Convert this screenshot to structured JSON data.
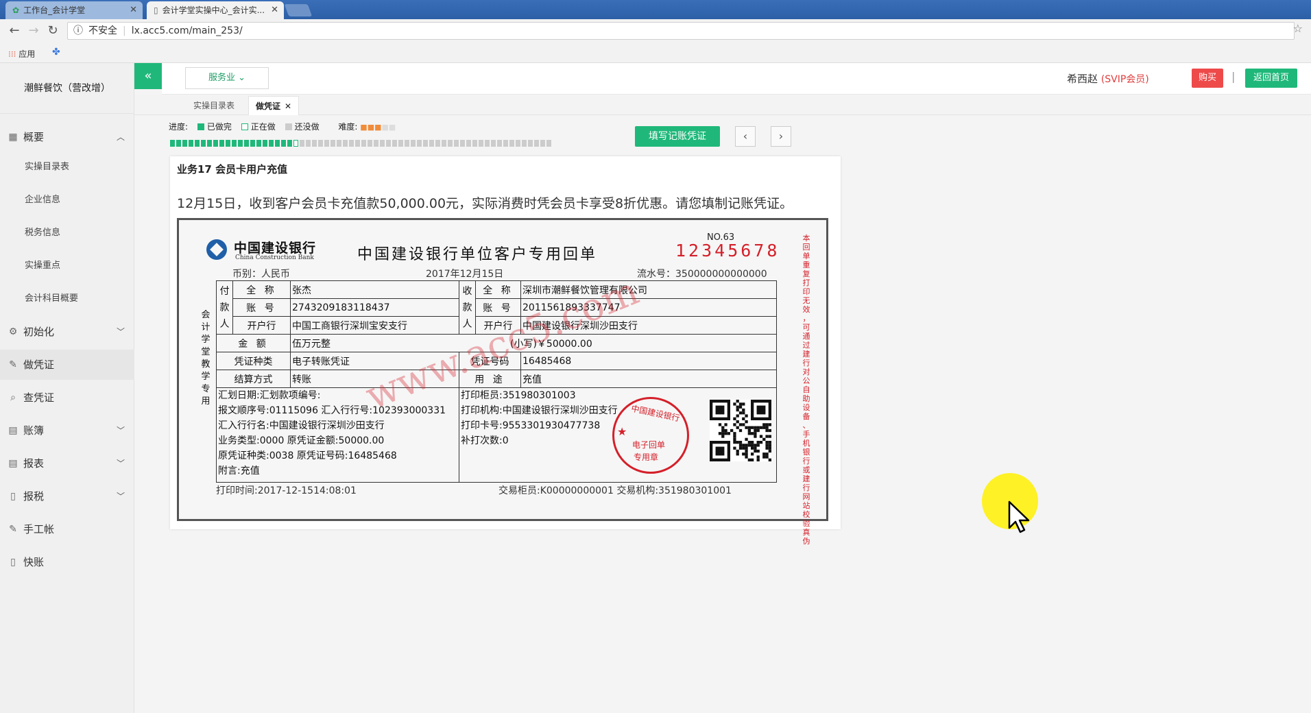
{
  "browser": {
    "tabs": [
      {
        "label": "工作台_会计学堂"
      },
      {
        "label": "会计学堂实操中心_会计实..."
      }
    ],
    "url": "lx.acc5.com/main_253/",
    "security_label": "不安全",
    "bookmarks_apps": "应用"
  },
  "sidebar": {
    "company": "潮鲜餐饮（营改增）",
    "menu": [
      {
        "label": "概要"
      },
      {
        "label": "初始化"
      },
      {
        "label": "做凭证"
      },
      {
        "label": "查凭证"
      },
      {
        "label": "账簿"
      },
      {
        "label": "报表"
      },
      {
        "label": "报税"
      },
      {
        "label": "手工帐"
      },
      {
        "label": "快账"
      }
    ],
    "submenu": [
      {
        "label": "实操目录表"
      },
      {
        "label": "企业信息"
      },
      {
        "label": "税务信息"
      },
      {
        "label": "实操重点"
      },
      {
        "label": "会计科目概要"
      }
    ]
  },
  "header": {
    "service_dropdown": "服务业",
    "user_name": "希西赵",
    "vip_label": "(SVIP会员)",
    "buy_label": "购买",
    "home_label": "返回首页"
  },
  "page_tabs": [
    {
      "label": "实操目录表"
    },
    {
      "label": "做凭证"
    }
  ],
  "progress": {
    "label": "进度:",
    "done": "已做完",
    "doing": "正在做",
    "todo": "还没做",
    "difficulty_label": "难度:",
    "difficulty_level": 3,
    "difficulty_max": 5,
    "done_count": 20,
    "current_index": 21,
    "total_segments": 62,
    "fill_button": "填写记账凭证"
  },
  "colors": {
    "accent": "#1fb87a",
    "danger": "#ee4a4a",
    "seal_red": "#d4202a",
    "bank_blue": "#1f5fa8"
  },
  "task": {
    "title": "业务17 会员卡用户充值",
    "description": "12月15日，收到客户会员卡充值款50,000.00元，实际消费时凭会员卡享受8折优惠。请您填制记账凭证。"
  },
  "receipt": {
    "bank_cn": "中国建设银行",
    "bank_en": "China Construction Bank",
    "title": "中国建设银行单位客户专用回单",
    "no_label": "NO.63",
    "no_value": "12345678",
    "currency": "币别：人民币",
    "date": "2017年12月15日",
    "serial": "流水号：350000000000000",
    "payer_tag": [
      "付",
      "款",
      "人"
    ],
    "payee_tag": [
      "收",
      "款",
      "人"
    ],
    "lbl_name": "全 称",
    "lbl_account": "账 号",
    "lbl_bank": "开户行",
    "lbl_amount": "金 额",
    "lbl_vtype": "凭证种类",
    "lbl_vno": "凭证号码",
    "lbl_settle": "结算方式",
    "lbl_use": "用 途",
    "payer_name": "张杰",
    "payer_account": "2743209183118437",
    "payer_bank": "中国工商银行深圳宝安支行",
    "payee_name": "深圳市潮鲜餐饮管理有限公司",
    "payee_account": "2011561893337747",
    "payee_bank": "中国建设银行深圳沙田支行",
    "amount_cn": "伍万元整",
    "amount_small": "(小写)￥50000.00",
    "voucher_type": "电子转账凭证",
    "voucher_no": "16485468",
    "settle_method": "转账",
    "purpose": "充值",
    "left_info": [
      "汇划日期:汇划款项编号:",
      "报文顺序号:01115096 汇入行行号:102393000331",
      "汇入行行名:中国建设银行深圳沙田支行",
      "业务类型:0000 原凭证金额:50000.00",
      "原凭证种类:0038 原凭证号码:16485468",
      "附言:充值"
    ],
    "right_info": [
      "打印柜员:351980301003",
      "打印机构:中国建设银行深圳沙田支行",
      "打印卡号:9553301930477738",
      "补打次数:0"
    ],
    "print_time": "打印时间:2017-12-1514:08:01",
    "trade_info": "交易柜员:K00000000001 交易机构:351980301001",
    "left_vertical": "会计学堂教学专用",
    "right_vertical": "本回单重复打印无效，可通过建行对公自助设备、手机银行或建行网站校验真伪",
    "seal_top": "中国建设银行",
    "seal_line1": "电子回单",
    "seal_line2": "专用章",
    "watermark": "www.acc5.com"
  }
}
